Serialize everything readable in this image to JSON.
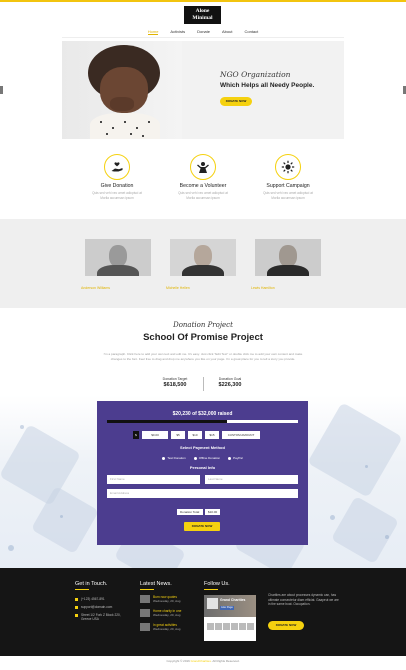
{
  "brand": {
    "line1": "Alone",
    "line2": "Minimal"
  },
  "nav": {
    "items": [
      "Home",
      "Activists",
      "Donate",
      "About",
      "Contact"
    ]
  },
  "hero": {
    "org": "NGO Organization",
    "tagline": "Which Helps all Needy People.",
    "button": "DONATE NOW"
  },
  "features": [
    {
      "icon": "hand-heart-icon",
      "title": "Give Donation",
      "desc": "Quis sed vehi vec amet adicpisci at\nMorlla accumsan ipsum"
    },
    {
      "icon": "volunteer-people-icon",
      "title": "Become a Volunteer",
      "desc": "Quis sed vehi vec amet adicpisci at\nMorlla accumsan ipsum"
    },
    {
      "icon": "campaign-sun-icon",
      "title": "Support Campaign",
      "desc": "Quis sed vehi vec amet adicpisci at\nMorlla accumsan ipsum"
    }
  ],
  "team": [
    {
      "name": "Anderson Williams"
    },
    {
      "name": "Michelle Hellen"
    },
    {
      "name": "Lewis Hamilton"
    }
  ],
  "project": {
    "subtitle": "Donation Project",
    "title": "School Of Promise Project",
    "description": "I'm a paragraph. Click here to add your own text and edit me. It's easy. Just click \"Edit Text\" or double click me to add your own content and make changes to the font. Feel free to drag and drop me anywhere you like on your page. I'm a great place for you to tell a story you provide.",
    "target_label": "Donation Target",
    "target_value": "$618,500",
    "goal_label": "Donation Goal",
    "goal_value": "$226,300"
  },
  "form": {
    "raised": "$20,230 of $32,000 raised",
    "progress": 0.63,
    "currency": "$",
    "amounts": [
      "$0.00",
      "$5",
      "$10",
      "$15"
    ],
    "custom": "CUSTOM AMOUNT",
    "payment_title": "Select Payment Method",
    "payment_options": [
      "Test Donation",
      "Offline Donation",
      "PayPal"
    ],
    "personal_title": "Personal Info",
    "first_name": "First Name",
    "last_name": "Last Name",
    "email": "Email Address",
    "total_label": "Donation Total:",
    "total_value": "$10.00",
    "donate_button": "DONATE NOW"
  },
  "footer": {
    "touch_title": "Get in Touch.",
    "phone": "(+123) 4567-891",
    "email": "support@domain.com",
    "address1": "Street 1/2 Fork Z Block 220,",
    "address2": "Greece USA",
    "news_title": "Latest News.",
    "news": [
      {
        "title": "Burn now quotes",
        "date": "Wednesday, 20, Aug"
      },
      {
        "title": "Home charity in one",
        "date": "Wednesday, 20, Aug"
      },
      {
        "title": "In great activities",
        "date": "Wednesday, 20, Aug"
      }
    ],
    "follow_title": "Follow Us.",
    "fb_name": "Grand Charities",
    "fb_like": "Like Page",
    "about": "Charities are about processes dynamic can, has ultimate consectetur diam efficiat. Gaapeut we are in the same boat. Occupation.",
    "donate_button": "DONATE NOW",
    "copyright_pre": "Copyright © 2016",
    "copyright_brand": "GrandCharities",
    "copyright_post": ". All Rights Reserved."
  }
}
